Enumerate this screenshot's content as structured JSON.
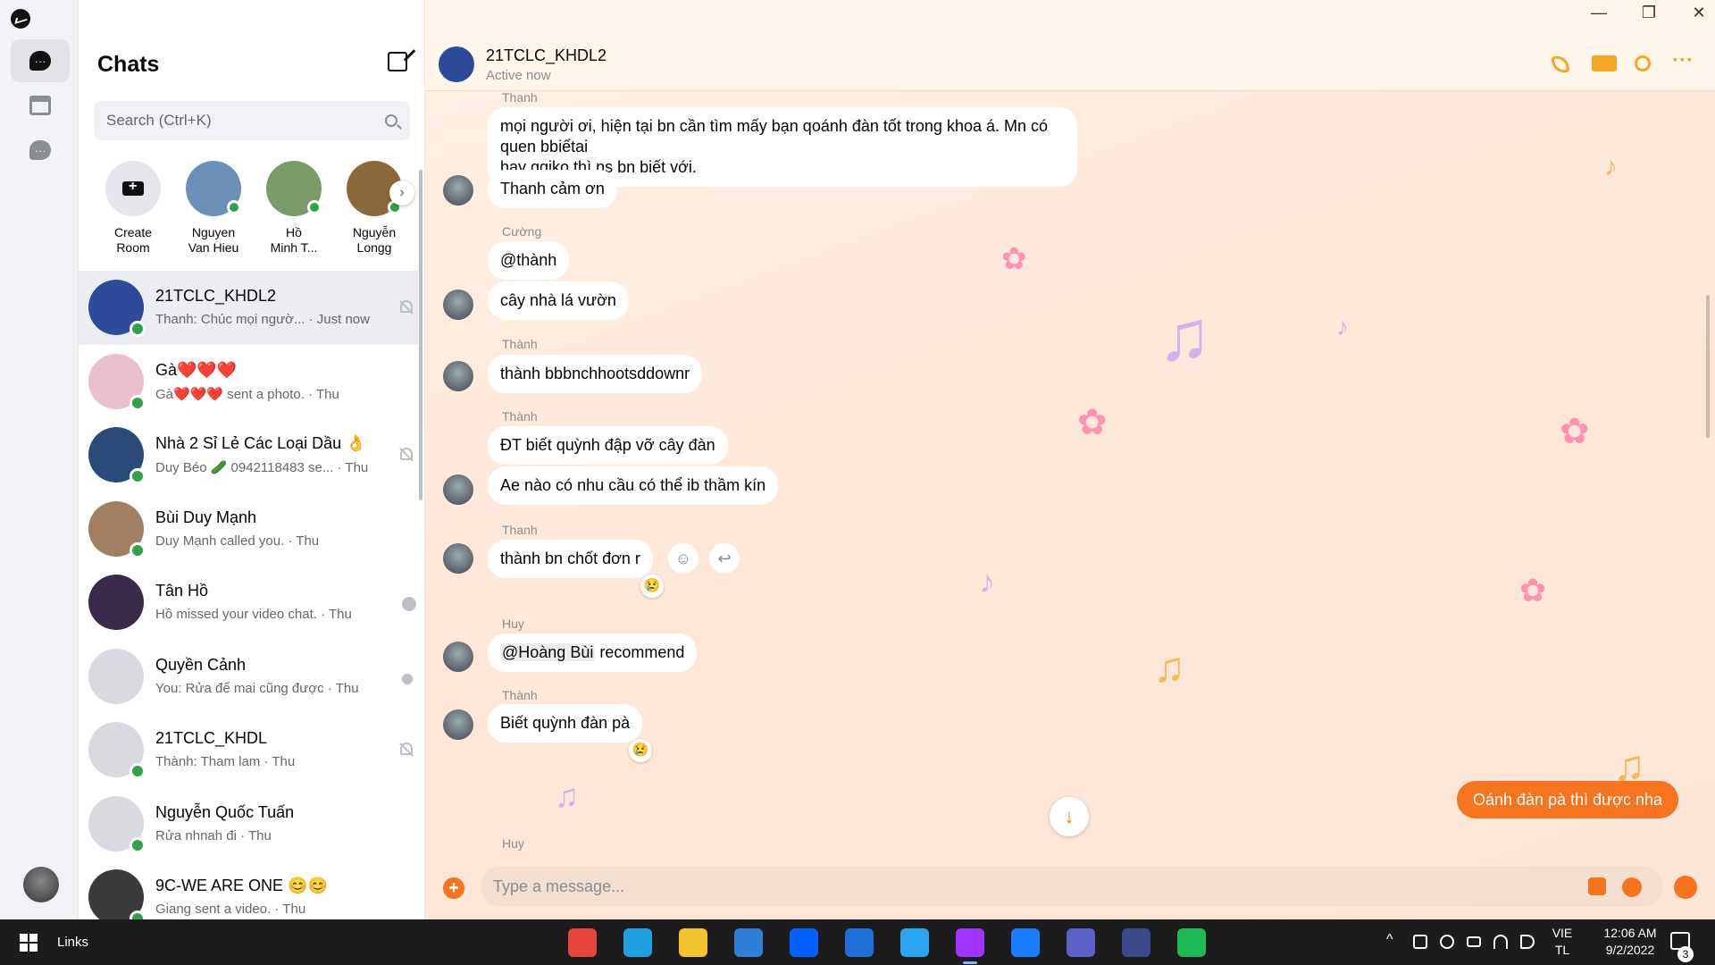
{
  "window": {
    "minimize": "—",
    "restore": "❐",
    "close": "✕"
  },
  "sidebar": {
    "title": "Chats",
    "search_placeholder": "Search (Ctrl+K)"
  },
  "stories": [
    {
      "name": "Create\nRoom",
      "line1": "Create",
      "line2": "Room"
    },
    {
      "line1": "Nguyen",
      "line2": "Van Hieu",
      "online": true,
      "color": "#6a8fb8"
    },
    {
      "line1": "Hồ",
      "line2": "Minh T...",
      "online": true,
      "color": "#7a9a6a"
    },
    {
      "line1": "Nguyễn",
      "line2": "Longg",
      "online": true,
      "color": "#8a6a3a"
    }
  ],
  "conversations": [
    {
      "title": "21TCLC_KHDL2",
      "sub": "Thanh: Chúc mọi ngườ... · Just now",
      "online": true,
      "status": "muted",
      "color": "#2e4a9b"
    },
    {
      "title": "Gà❤️❤️❤️",
      "sub": "Gà❤️❤️❤️ sent a photo. · Thu",
      "online": true,
      "status": "",
      "color": "#e9c0d0"
    },
    {
      "title": "Nhà 2 Sỉ Lẻ Các Loại Dầu 👌",
      "sub": "Duy Béo 🥒 0942118483 se... · Thu",
      "online": true,
      "status": "muted",
      "color": "#2a4a7a"
    },
    {
      "title": "Bùi Duy Mạnh",
      "sub": "Duy Mạnh called you. · Thu",
      "online": true,
      "status": "",
      "color": "#a08060"
    },
    {
      "title": "Tân Hồ",
      "sub": "Hồ missed your video chat. · Thu",
      "online": false,
      "status": "read",
      "color": "#3a2a4a"
    },
    {
      "title": "Quyền Cảnh",
      "sub": "You: Rửa để mai cũng được · Thu",
      "online": false,
      "status": "seen",
      "color": "#d8dadf"
    },
    {
      "title": "21TCLC_KHDL",
      "sub": "Thành: Tham lam · Thu",
      "online": true,
      "status": "muted",
      "color": "#d8dadf"
    },
    {
      "title": "Nguyễn Quốc Tuấn",
      "sub": "Rửa nhnah đi · Thu",
      "online": true,
      "status": "",
      "color": "#d8dadf"
    },
    {
      "title": "9C-WE ARE ONE 😊😊",
      "sub": "Giang sent a video. · Thu",
      "online": true,
      "status": "",
      "color": "#3a3a3a"
    }
  ],
  "header": {
    "title": "21TCLC_KHDL2",
    "status": "Active now"
  },
  "messages": {
    "m1_sender": "Thanh",
    "m1_line1": "mọi người ơi, hiện tại bn cần tìm mấy bạn qoánh đàn tốt trong khoa á. Mn có quen bbiếtai",
    "m1_line2": "hay ggiko thì ns bn biết với.",
    "m2": "Thanh cảm ơn",
    "m3_sender": "Cường",
    "m3": "@thành",
    "m4": "cây nhà lá vườn",
    "m5_sender": "Thành",
    "m5": "thành bbbnchhootsddownr",
    "m6_sender": "Thành",
    "m6": "ĐT biết quỳnh đập vỡ cây đàn",
    "m7": "Ae nào có nhu cầu có thể ib thầm kín",
    "m8_sender": "Thanh",
    "m8": "thành bn chốt đơn r",
    "m8_react": "😢",
    "m9_sender": "Huy",
    "m9_mention": "@Hoàng Bùi",
    "m9_rest": " recommend",
    "m10_sender": "Thành",
    "m10": "Biết quỳnh đàn pà",
    "m10_react": "😢",
    "m11_sender": "Huy",
    "mine": "Oánh đàn pà thì được nha"
  },
  "composer": {
    "placeholder": "Type a message..."
  },
  "taskbar": {
    "links": "Links",
    "lang1": "VIE",
    "lang2": "TL",
    "time": "12:06 AM",
    "date": "9/2/2022",
    "notifications": "3",
    "apps": [
      {
        "name": "chrome",
        "color": "#e8453c"
      },
      {
        "name": "edge",
        "color": "#1fa0e0"
      },
      {
        "name": "file-explorer",
        "color": "#f4c430"
      },
      {
        "name": "mail",
        "color": "#2f7fd6"
      },
      {
        "name": "dropbox",
        "color": "#0061fe"
      },
      {
        "name": "app-blue",
        "color": "#1e6fd9"
      },
      {
        "name": "vscode",
        "color": "#2aa4f4"
      },
      {
        "name": "messenger",
        "color": "#a033ff"
      },
      {
        "name": "zalo",
        "color": "#1a7cff"
      },
      {
        "name": "teams",
        "color": "#5b5fc7"
      },
      {
        "name": "devc",
        "color": "#3b4a8a"
      },
      {
        "name": "spotify",
        "color": "#1db954"
      }
    ]
  },
  "colors": {
    "accent": "#f7741f",
    "online": "#31a24c"
  }
}
